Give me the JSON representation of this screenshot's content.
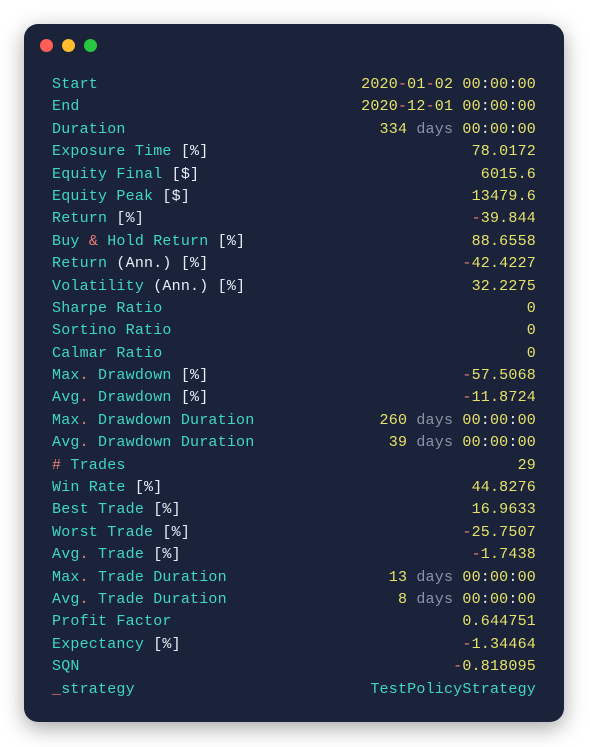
{
  "window": {
    "traffic_lights": [
      "close",
      "minimize",
      "zoom"
    ]
  },
  "rows": [
    {
      "label": [
        {
          "t": "Start",
          "cls": "c-teal"
        }
      ],
      "value": [
        {
          "t": "2020",
          "cls": "c-yellow"
        },
        {
          "t": "-",
          "cls": "c-red"
        },
        {
          "t": "01",
          "cls": "c-yellow"
        },
        {
          "t": "-",
          "cls": "c-red"
        },
        {
          "t": "02 ",
          "cls": "c-yellow"
        },
        {
          "t": "00",
          "cls": "c-yellow"
        },
        {
          "t": ":",
          "cls": "c-white"
        },
        {
          "t": "00",
          "cls": "c-yellow"
        },
        {
          "t": ":",
          "cls": "c-white"
        },
        {
          "t": "00",
          "cls": "c-yellow"
        }
      ]
    },
    {
      "label": [
        {
          "t": "End",
          "cls": "c-teal"
        }
      ],
      "value": [
        {
          "t": "2020",
          "cls": "c-yellow"
        },
        {
          "t": "-",
          "cls": "c-red"
        },
        {
          "t": "12",
          "cls": "c-yellow"
        },
        {
          "t": "-",
          "cls": "c-red"
        },
        {
          "t": "01 ",
          "cls": "c-yellow"
        },
        {
          "t": "00",
          "cls": "c-yellow"
        },
        {
          "t": ":",
          "cls": "c-white"
        },
        {
          "t": "00",
          "cls": "c-yellow"
        },
        {
          "t": ":",
          "cls": "c-white"
        },
        {
          "t": "00",
          "cls": "c-yellow"
        }
      ]
    },
    {
      "label": [
        {
          "t": "Duration",
          "cls": "c-teal"
        }
      ],
      "value": [
        {
          "t": "334 ",
          "cls": "c-yellow"
        },
        {
          "t": "days ",
          "cls": "c-gray"
        },
        {
          "t": "00",
          "cls": "c-yellow"
        },
        {
          "t": ":",
          "cls": "c-white"
        },
        {
          "t": "00",
          "cls": "c-yellow"
        },
        {
          "t": ":",
          "cls": "c-white"
        },
        {
          "t": "00",
          "cls": "c-yellow"
        }
      ]
    },
    {
      "label": [
        {
          "t": "Exposure Time ",
          "cls": "c-teal"
        },
        {
          "t": "[%]",
          "cls": "c-white"
        }
      ],
      "value": [
        {
          "t": "78.0172",
          "cls": "c-yellow"
        }
      ]
    },
    {
      "label": [
        {
          "t": "Equity Final ",
          "cls": "c-teal"
        },
        {
          "t": "[$]",
          "cls": "c-white"
        }
      ],
      "value": [
        {
          "t": "6015.6",
          "cls": "c-yellow"
        }
      ]
    },
    {
      "label": [
        {
          "t": "Equity Peak ",
          "cls": "c-teal"
        },
        {
          "t": "[$]",
          "cls": "c-white"
        }
      ],
      "value": [
        {
          "t": "13479.6",
          "cls": "c-yellow"
        }
      ]
    },
    {
      "label": [
        {
          "t": "Return ",
          "cls": "c-teal"
        },
        {
          "t": "[%]",
          "cls": "c-white"
        }
      ],
      "value": [
        {
          "t": "-",
          "cls": "c-red"
        },
        {
          "t": "39.844",
          "cls": "c-yellow"
        }
      ]
    },
    {
      "label": [
        {
          "t": "Buy ",
          "cls": "c-teal"
        },
        {
          "t": "& ",
          "cls": "c-red"
        },
        {
          "t": "Hold Return ",
          "cls": "c-teal"
        },
        {
          "t": "[%]",
          "cls": "c-white"
        }
      ],
      "value": [
        {
          "t": "88.6558",
          "cls": "c-yellow"
        }
      ]
    },
    {
      "label": [
        {
          "t": "Return ",
          "cls": "c-teal"
        },
        {
          "t": "(Ann.) ",
          "cls": "c-white"
        },
        {
          "t": "[%]",
          "cls": "c-white"
        }
      ],
      "value": [
        {
          "t": "-",
          "cls": "c-red"
        },
        {
          "t": "42.4227",
          "cls": "c-yellow"
        }
      ]
    },
    {
      "label": [
        {
          "t": "Volatility ",
          "cls": "c-teal"
        },
        {
          "t": "(Ann.) ",
          "cls": "c-white"
        },
        {
          "t": "[%]",
          "cls": "c-white"
        }
      ],
      "value": [
        {
          "t": "32.2275",
          "cls": "c-yellow"
        }
      ]
    },
    {
      "label": [
        {
          "t": "Sharpe Ratio",
          "cls": "c-teal"
        }
      ],
      "value": [
        {
          "t": "0",
          "cls": "c-yellow"
        }
      ]
    },
    {
      "label": [
        {
          "t": "Sortino Ratio",
          "cls": "c-teal"
        }
      ],
      "value": [
        {
          "t": "0",
          "cls": "c-yellow"
        }
      ]
    },
    {
      "label": [
        {
          "t": "Calmar Ratio",
          "cls": "c-teal"
        }
      ],
      "value": [
        {
          "t": "0",
          "cls": "c-yellow"
        }
      ]
    },
    {
      "label": [
        {
          "t": "Max",
          "cls": "c-teal"
        },
        {
          "t": ". ",
          "cls": "c-red"
        },
        {
          "t": "Drawdown ",
          "cls": "c-teal"
        },
        {
          "t": "[%]",
          "cls": "c-white"
        }
      ],
      "value": [
        {
          "t": "-",
          "cls": "c-red"
        },
        {
          "t": "57.5068",
          "cls": "c-yellow"
        }
      ]
    },
    {
      "label": [
        {
          "t": "Avg",
          "cls": "c-teal"
        },
        {
          "t": ". ",
          "cls": "c-red"
        },
        {
          "t": "Drawdown ",
          "cls": "c-teal"
        },
        {
          "t": "[%]",
          "cls": "c-white"
        }
      ],
      "value": [
        {
          "t": "-",
          "cls": "c-red"
        },
        {
          "t": "11.8724",
          "cls": "c-yellow"
        }
      ]
    },
    {
      "label": [
        {
          "t": "Max",
          "cls": "c-teal"
        },
        {
          "t": ". ",
          "cls": "c-red"
        },
        {
          "t": "Drawdown Duration",
          "cls": "c-teal"
        }
      ],
      "value": [
        {
          "t": "260 ",
          "cls": "c-yellow"
        },
        {
          "t": "days ",
          "cls": "c-gray"
        },
        {
          "t": "00",
          "cls": "c-yellow"
        },
        {
          "t": ":",
          "cls": "c-white"
        },
        {
          "t": "00",
          "cls": "c-yellow"
        },
        {
          "t": ":",
          "cls": "c-white"
        },
        {
          "t": "00",
          "cls": "c-yellow"
        }
      ]
    },
    {
      "label": [
        {
          "t": "Avg",
          "cls": "c-teal"
        },
        {
          "t": ". ",
          "cls": "c-red"
        },
        {
          "t": "Drawdown Duration",
          "cls": "c-teal"
        }
      ],
      "value": [
        {
          "t": "39 ",
          "cls": "c-yellow"
        },
        {
          "t": "days ",
          "cls": "c-gray"
        },
        {
          "t": "00",
          "cls": "c-yellow"
        },
        {
          "t": ":",
          "cls": "c-white"
        },
        {
          "t": "00",
          "cls": "c-yellow"
        },
        {
          "t": ":",
          "cls": "c-white"
        },
        {
          "t": "00",
          "cls": "c-yellow"
        }
      ]
    },
    {
      "label": [
        {
          "t": "# ",
          "cls": "c-red"
        },
        {
          "t": "Trades",
          "cls": "c-teal"
        }
      ],
      "value": [
        {
          "t": "29",
          "cls": "c-yellow"
        }
      ]
    },
    {
      "label": [
        {
          "t": "Win Rate ",
          "cls": "c-teal"
        },
        {
          "t": "[%]",
          "cls": "c-white"
        }
      ],
      "value": [
        {
          "t": "44.8276",
          "cls": "c-yellow"
        }
      ]
    },
    {
      "label": [
        {
          "t": "Best Trade ",
          "cls": "c-teal"
        },
        {
          "t": "[%]",
          "cls": "c-white"
        }
      ],
      "value": [
        {
          "t": "16.9633",
          "cls": "c-yellow"
        }
      ]
    },
    {
      "label": [
        {
          "t": "Worst Trade ",
          "cls": "c-teal"
        },
        {
          "t": "[%]",
          "cls": "c-white"
        }
      ],
      "value": [
        {
          "t": "-",
          "cls": "c-red"
        },
        {
          "t": "25.7507",
          "cls": "c-yellow"
        }
      ]
    },
    {
      "label": [
        {
          "t": "Avg",
          "cls": "c-teal"
        },
        {
          "t": ". ",
          "cls": "c-red"
        },
        {
          "t": "Trade ",
          "cls": "c-teal"
        },
        {
          "t": "[%]",
          "cls": "c-white"
        }
      ],
      "value": [
        {
          "t": "-",
          "cls": "c-red"
        },
        {
          "t": "1.7438",
          "cls": "c-yellow"
        }
      ]
    },
    {
      "label": [
        {
          "t": "Max",
          "cls": "c-teal"
        },
        {
          "t": ". ",
          "cls": "c-red"
        },
        {
          "t": "Trade Duration",
          "cls": "c-teal"
        }
      ],
      "value": [
        {
          "t": "13 ",
          "cls": "c-yellow"
        },
        {
          "t": "days ",
          "cls": "c-gray"
        },
        {
          "t": "00",
          "cls": "c-yellow"
        },
        {
          "t": ":",
          "cls": "c-white"
        },
        {
          "t": "00",
          "cls": "c-yellow"
        },
        {
          "t": ":",
          "cls": "c-white"
        },
        {
          "t": "00",
          "cls": "c-yellow"
        }
      ]
    },
    {
      "label": [
        {
          "t": "Avg",
          "cls": "c-teal"
        },
        {
          "t": ". ",
          "cls": "c-red"
        },
        {
          "t": "Trade Duration",
          "cls": "c-teal"
        }
      ],
      "value": [
        {
          "t": "8 ",
          "cls": "c-yellow"
        },
        {
          "t": "days ",
          "cls": "c-gray"
        },
        {
          "t": "00",
          "cls": "c-yellow"
        },
        {
          "t": ":",
          "cls": "c-white"
        },
        {
          "t": "00",
          "cls": "c-yellow"
        },
        {
          "t": ":",
          "cls": "c-white"
        },
        {
          "t": "00",
          "cls": "c-yellow"
        }
      ]
    },
    {
      "label": [
        {
          "t": "Profit Factor",
          "cls": "c-teal"
        }
      ],
      "value": [
        {
          "t": "0.644751",
          "cls": "c-yellow"
        }
      ]
    },
    {
      "label": [
        {
          "t": "Expectancy ",
          "cls": "c-teal"
        },
        {
          "t": "[%]",
          "cls": "c-white"
        }
      ],
      "value": [
        {
          "t": "-",
          "cls": "c-red"
        },
        {
          "t": "1.34464",
          "cls": "c-yellow"
        }
      ]
    },
    {
      "label": [
        {
          "t": "SQN",
          "cls": "c-teal"
        }
      ],
      "value": [
        {
          "t": "-",
          "cls": "c-red"
        },
        {
          "t": "0.818095",
          "cls": "c-yellow"
        }
      ]
    },
    {
      "label": [
        {
          "t": "_",
          "cls": "c-red"
        },
        {
          "t": "strategy",
          "cls": "c-teal"
        }
      ],
      "value": [
        {
          "t": "TestPolicyStrategy",
          "cls": "c-teal"
        }
      ]
    }
  ]
}
